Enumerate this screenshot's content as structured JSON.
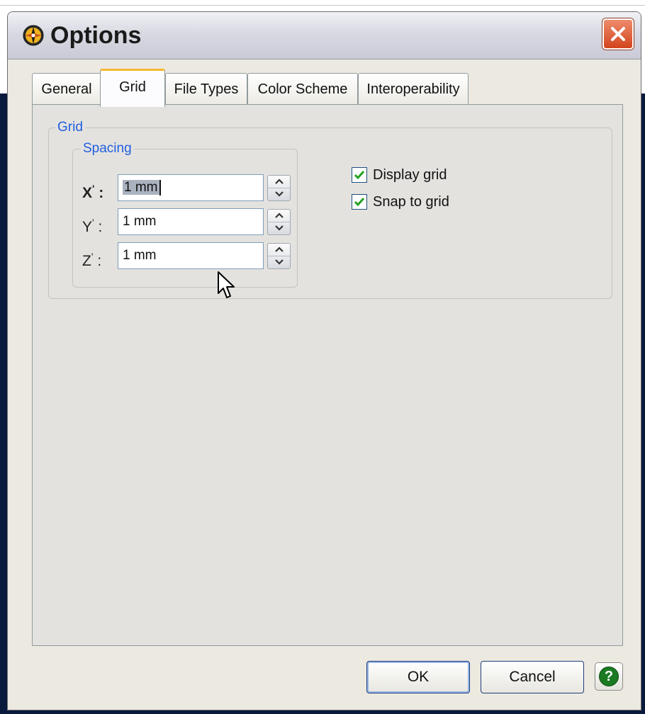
{
  "dialog": {
    "title": "Options",
    "app_icon": "compass-icon",
    "close_icon": "close-x-icon"
  },
  "tabs": [
    {
      "label": "General",
      "active": false
    },
    {
      "label": "Grid",
      "active": true
    },
    {
      "label": "File Types",
      "active": false
    },
    {
      "label": "Color Scheme",
      "active": false
    },
    {
      "label": "Interoperability",
      "active": false
    }
  ],
  "grid_group": {
    "label": "Grid",
    "spacing": {
      "label": "Spacing",
      "x": {
        "label": "X",
        "value": "1 mm"
      },
      "y": {
        "label": "Y",
        "value": "1 mm"
      },
      "z": {
        "label": "Z",
        "value": "1 mm"
      }
    },
    "display_grid": {
      "label": "Display grid",
      "checked": true
    },
    "snap_to_grid": {
      "label": "Snap to grid",
      "checked": true
    }
  },
  "buttons": {
    "ok": "OK",
    "cancel": "Cancel",
    "help_icon": "help-icon",
    "help_glyph": "?"
  },
  "colors": {
    "group_label": "#1f5fe0",
    "active_tab_accent": "#f6b82f",
    "close_button": "#d2451d",
    "help_button": "#1b7a22"
  }
}
